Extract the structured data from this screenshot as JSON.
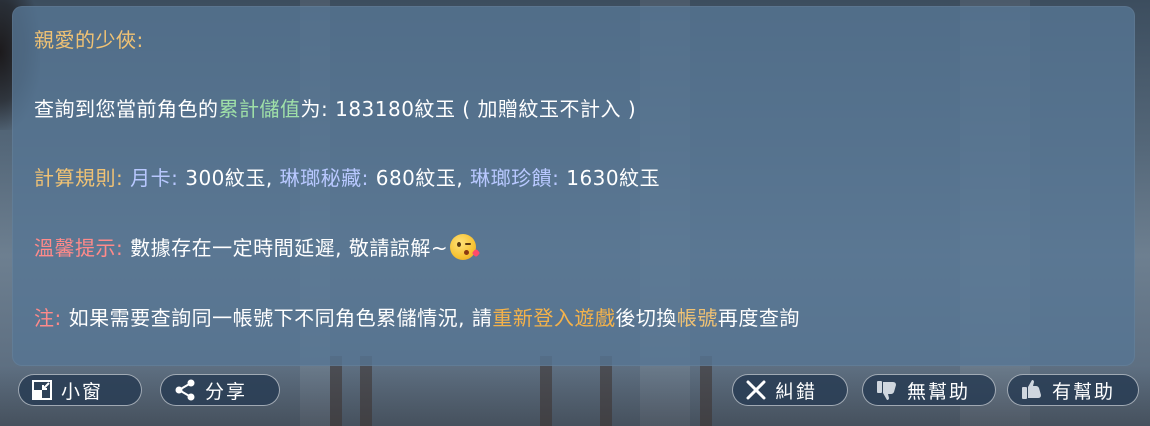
{
  "message": {
    "greeting": "親愛的少俠:",
    "line2": {
      "prefix": "查詢到您當前角色的",
      "highlight": "累計儲值",
      "middle": "为: 183180紋玉 ( 加贈紋玉不計入 )"
    },
    "line3": {
      "label": "計算規則:",
      "item1_name": "月卡:",
      "item1_value": "300紋玉,",
      "item2_name": "琳瑯秘藏:",
      "item2_value": "680紋玉,",
      "item3_name": "琳瑯珍饋:",
      "item3_value": "1630紋玉"
    },
    "line4": {
      "label": "溫馨提示:",
      "text": "數據存在一定時間延遲, 敬請諒解~",
      "emoji": "kissing-wink-emoji"
    },
    "line5": {
      "label": "注:",
      "prefix": "如果需要查詢同一帳號下不同角色累儲情況, 請",
      "action": "重新登入遊戲",
      "middle": "後切換",
      "account": "帳號",
      "suffix": "再度查詢"
    }
  },
  "buttons": {
    "small_window": "小窗",
    "share": "分享",
    "report_error": "糾錯",
    "not_helpful": "無幫助",
    "helpful": "有幫助"
  },
  "colors": {
    "panel": "#5676944d",
    "gold": "#f0c274",
    "green": "#9fe0a8",
    "blue": "#b8c8ff",
    "red": "#ff8a8a",
    "orange": "#f5b24a"
  }
}
